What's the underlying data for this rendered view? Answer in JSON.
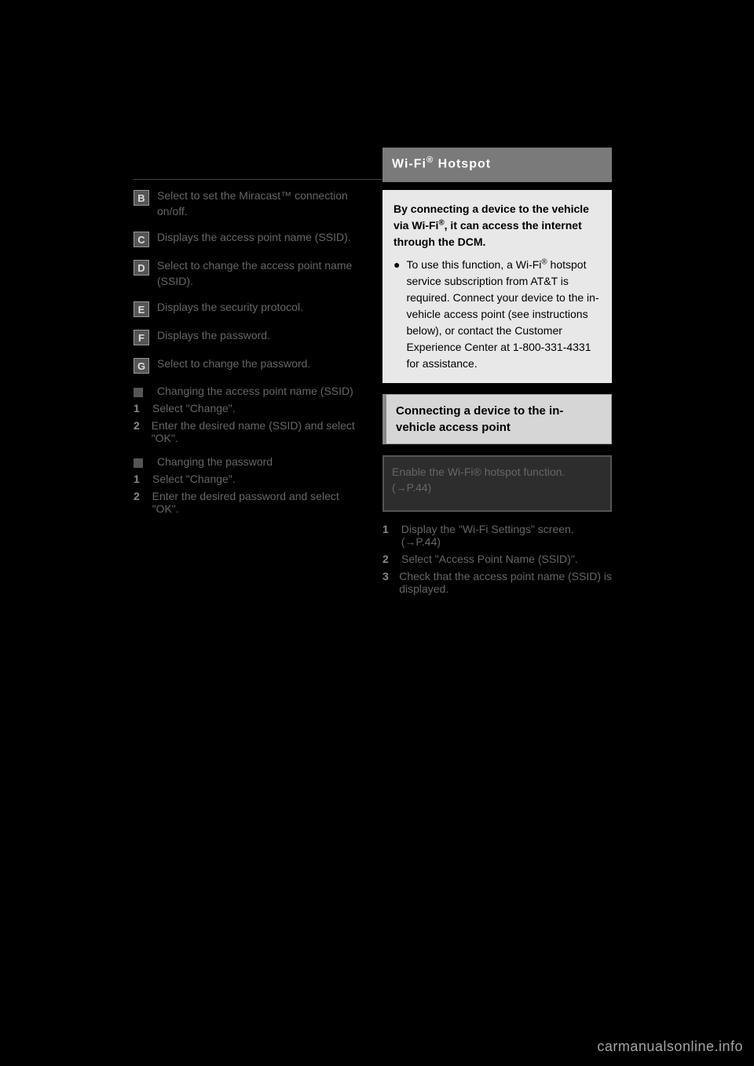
{
  "left": {
    "items": [
      {
        "letter": "B",
        "text": "Select to set the Miracast™ connection on/off."
      },
      {
        "letter": "C",
        "text": "Displays the access point name (SSID)."
      },
      {
        "letter": "D",
        "text": "Select to change the access point name (SSID)."
      },
      {
        "letter": "E",
        "text": "Displays the security protocol."
      },
      {
        "letter": "F",
        "text": "Displays the password."
      },
      {
        "letter": "G",
        "text": "Select to change the password."
      }
    ],
    "group1": {
      "heading": "Changing the access point name (SSID)",
      "steps": [
        "Select \"Change\".",
        "Enter the desired name (SSID) and select \"OK\"."
      ]
    },
    "group2": {
      "heading": "Changing the password",
      "steps": [
        "Select \"Change\".",
        "Enter the desired password and select \"OK\"."
      ]
    }
  },
  "right": {
    "title_a": "Wi-Fi",
    "title_b": " Hotspot",
    "lead_a": "By connecting a device to the vehicle via Wi-Fi",
    "lead_b": ", it can access the internet through the DCM.",
    "bullet_a": "To use this function, a Wi-Fi",
    "bullet_b": " hotspot service subscription from AT&T is required. Connect your device to the in-vehicle access point (see instructions below), or contact the Customer Experience Center at 1-800-331-4331 for assistance.",
    "subhead": "Connecting a device to the in-vehicle access point",
    "darkbox": "Enable the Wi-Fi® hotspot function. (→P.44)",
    "steps": [
      "Display the \"Wi-Fi Settings\" screen. (→P.44)",
      "Select \"Access Point Name (SSID)\".",
      "Check that the access point name (SSID) is displayed."
    ]
  },
  "watermark": "carmanualsonline.info"
}
